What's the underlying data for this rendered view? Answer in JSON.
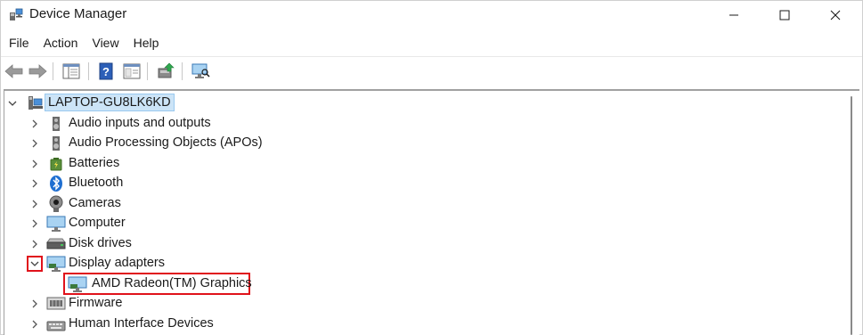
{
  "window": {
    "title": "Device Manager"
  },
  "menu": {
    "items": [
      "File",
      "Action",
      "View",
      "Help"
    ]
  },
  "tree": {
    "root": "LAPTOP-GU8LK6KD",
    "categories": [
      {
        "label": "Audio inputs and outputs",
        "icon": "speaker-icon"
      },
      {
        "label": "Audio Processing Objects (APOs)",
        "icon": "speaker-icon"
      },
      {
        "label": "Batteries",
        "icon": "battery-icon"
      },
      {
        "label": "Bluetooth",
        "icon": "bluetooth-icon"
      },
      {
        "label": "Cameras",
        "icon": "camera-icon"
      },
      {
        "label": "Computer",
        "icon": "computer-icon"
      },
      {
        "label": "Disk drives",
        "icon": "disk-drive-icon"
      },
      {
        "label": "Display adapters",
        "icon": "display-adapter-icon",
        "expanded": true
      },
      {
        "label": "Firmware",
        "icon": "firmware-icon"
      },
      {
        "label": "Human Interface Devices",
        "icon": "hid-icon"
      }
    ],
    "display_child": "AMD Radeon(TM) Graphics"
  },
  "colors": {
    "highlight": "#e0121b",
    "selection": "#cce4f7"
  }
}
